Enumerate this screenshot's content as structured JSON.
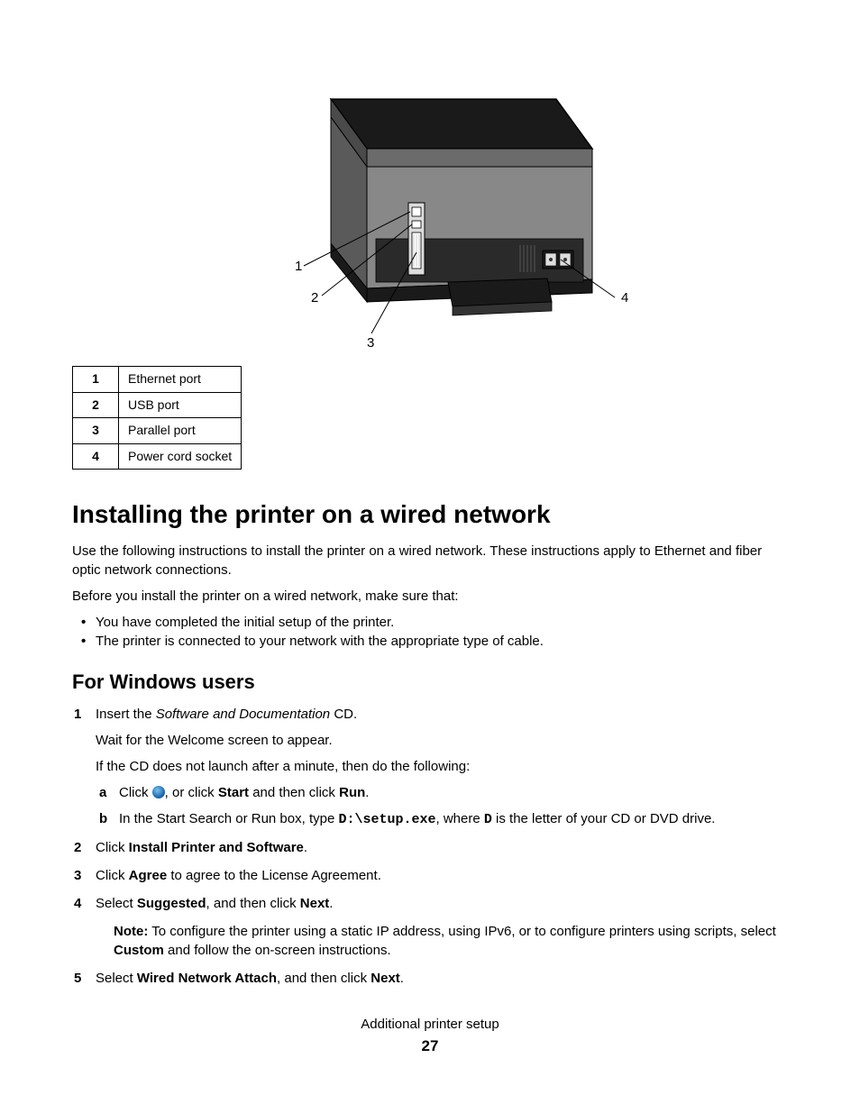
{
  "figure": {
    "callouts": [
      "1",
      "2",
      "3",
      "4"
    ]
  },
  "port_table": [
    {
      "num": "1",
      "label": "Ethernet port"
    },
    {
      "num": "2",
      "label": "USB port"
    },
    {
      "num": "3",
      "label": "Parallel port"
    },
    {
      "num": "4",
      "label": "Power cord socket"
    }
  ],
  "heading": "Installing the printer on a wired network",
  "intro": "Use the following instructions to install the printer on a wired network. These instructions apply to Ethernet and fiber optic network connections.",
  "before_intro": "Before you install the printer on a wired network, make sure that:",
  "prereqs": [
    "You have completed the initial setup of the printer.",
    "The printer is connected to your network with the appropriate type of cable."
  ],
  "subheading": "For Windows users",
  "step1": {
    "num": "1",
    "text_a": "Insert the ",
    "text_b": "Software and Documentation",
    "text_c": " CD.",
    "wait": "Wait for the Welcome screen to appear.",
    "ifnot": "If the CD does not launch after a minute, then do the following:",
    "sub_a": {
      "letter": "a",
      "t1": "Click ",
      "t2": ", or click ",
      "t3": "Start",
      "t4": " and then click ",
      "t5": "Run",
      "t6": "."
    },
    "sub_b": {
      "letter": "b",
      "t1": "In the Start Search or Run box, type ",
      "t2": "D:\\setup.exe",
      "t3": ", where ",
      "t4": "D",
      "t5": " is the letter of your CD or DVD drive."
    }
  },
  "step2": {
    "num": "2",
    "t1": "Click ",
    "t2": "Install Printer and Software",
    "t3": "."
  },
  "step3": {
    "num": "3",
    "t1": "Click ",
    "t2": "Agree",
    "t3": " to agree to the License Agreement."
  },
  "step4": {
    "num": "4",
    "t1": "Select ",
    "t2": "Suggested",
    "t3": ", and then click ",
    "t4": "Next",
    "t5": ".",
    "note_label": "Note:",
    "note_t1": " To configure the printer using a static IP address, using IPv6, or to configure printers using scripts, select ",
    "note_t2": "Custom",
    "note_t3": " and follow the on-screen instructions."
  },
  "step5": {
    "num": "5",
    "t1": "Select ",
    "t2": "Wired Network Attach",
    "t3": ", and then click ",
    "t4": "Next",
    "t5": "."
  },
  "footer": {
    "section": "Additional printer setup",
    "page": "27"
  }
}
